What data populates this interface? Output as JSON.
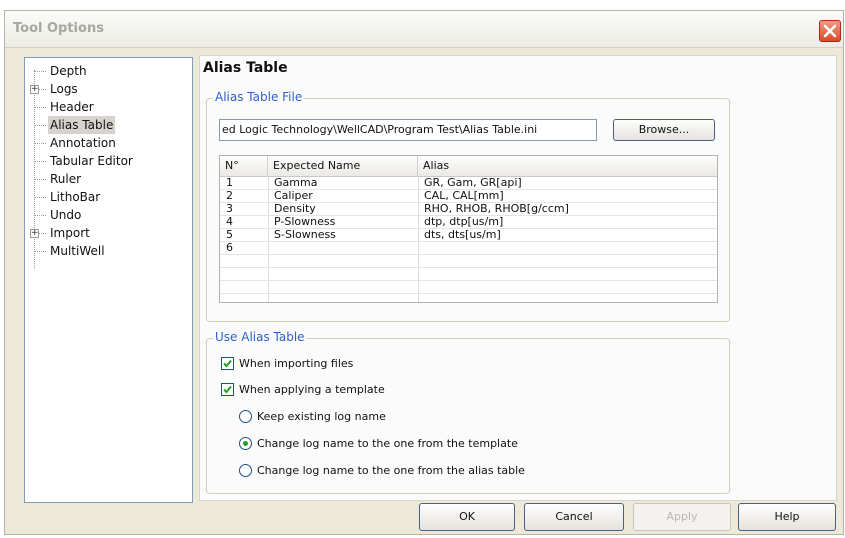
{
  "window": {
    "title": "Tool Options"
  },
  "tree": {
    "items": [
      {
        "label": "Depth",
        "expandable": false
      },
      {
        "label": "Logs",
        "expandable": true
      },
      {
        "label": "Header",
        "expandable": false
      },
      {
        "label": "Alias Table",
        "expandable": false,
        "selected": true
      },
      {
        "label": "Annotation",
        "expandable": false
      },
      {
        "label": "Tabular Editor",
        "expandable": false
      },
      {
        "label": "Ruler",
        "expandable": false
      },
      {
        "label": "LithoBar",
        "expandable": false
      },
      {
        "label": "Undo",
        "expandable": false
      },
      {
        "label": "Import",
        "expandable": true
      },
      {
        "label": "MultiWell",
        "expandable": false
      }
    ]
  },
  "panel": {
    "heading": "Alias Table",
    "file_group": {
      "title": "Alias Table File",
      "path_value": "ed Logic Technology\\WellCAD\\Program Test\\Alias Table.ini",
      "browse_label": "Browse..."
    },
    "table": {
      "columns": [
        "N°",
        "Expected Name",
        "Alias"
      ],
      "rows": [
        [
          "1",
          "Gamma",
          "GR, Gam, GR[api]"
        ],
        [
          "2",
          "Caliper",
          "CAL, CAL[mm]"
        ],
        [
          "3",
          "Density",
          "RHO, RHOB, RHOB[g/ccm]"
        ],
        [
          "4",
          "P-Slowness",
          "dtp, dtp[us/m]"
        ],
        [
          "5",
          "S-Slowness",
          "dts, dts[us/m]"
        ],
        [
          "6",
          "",
          ""
        ],
        [
          "",
          "",
          ""
        ],
        [
          "",
          "",
          ""
        ],
        [
          "",
          "",
          ""
        ]
      ]
    },
    "use_group": {
      "title": "Use Alias Table",
      "check_importing": "When importing files",
      "check_template": "When applying a template",
      "radio_keep": "Keep existing log name",
      "radio_template": "Change log name to the one from the template",
      "radio_alias": "Change log name to the one from the alias table"
    }
  },
  "buttons": {
    "ok": "OK",
    "cancel": "Cancel",
    "apply": "Apply",
    "help": "Help"
  },
  "colors": {
    "group_title": "#2f5fc6",
    "close": "#d84a2a",
    "radio_dot": "#21a121",
    "check": "#21a121"
  }
}
